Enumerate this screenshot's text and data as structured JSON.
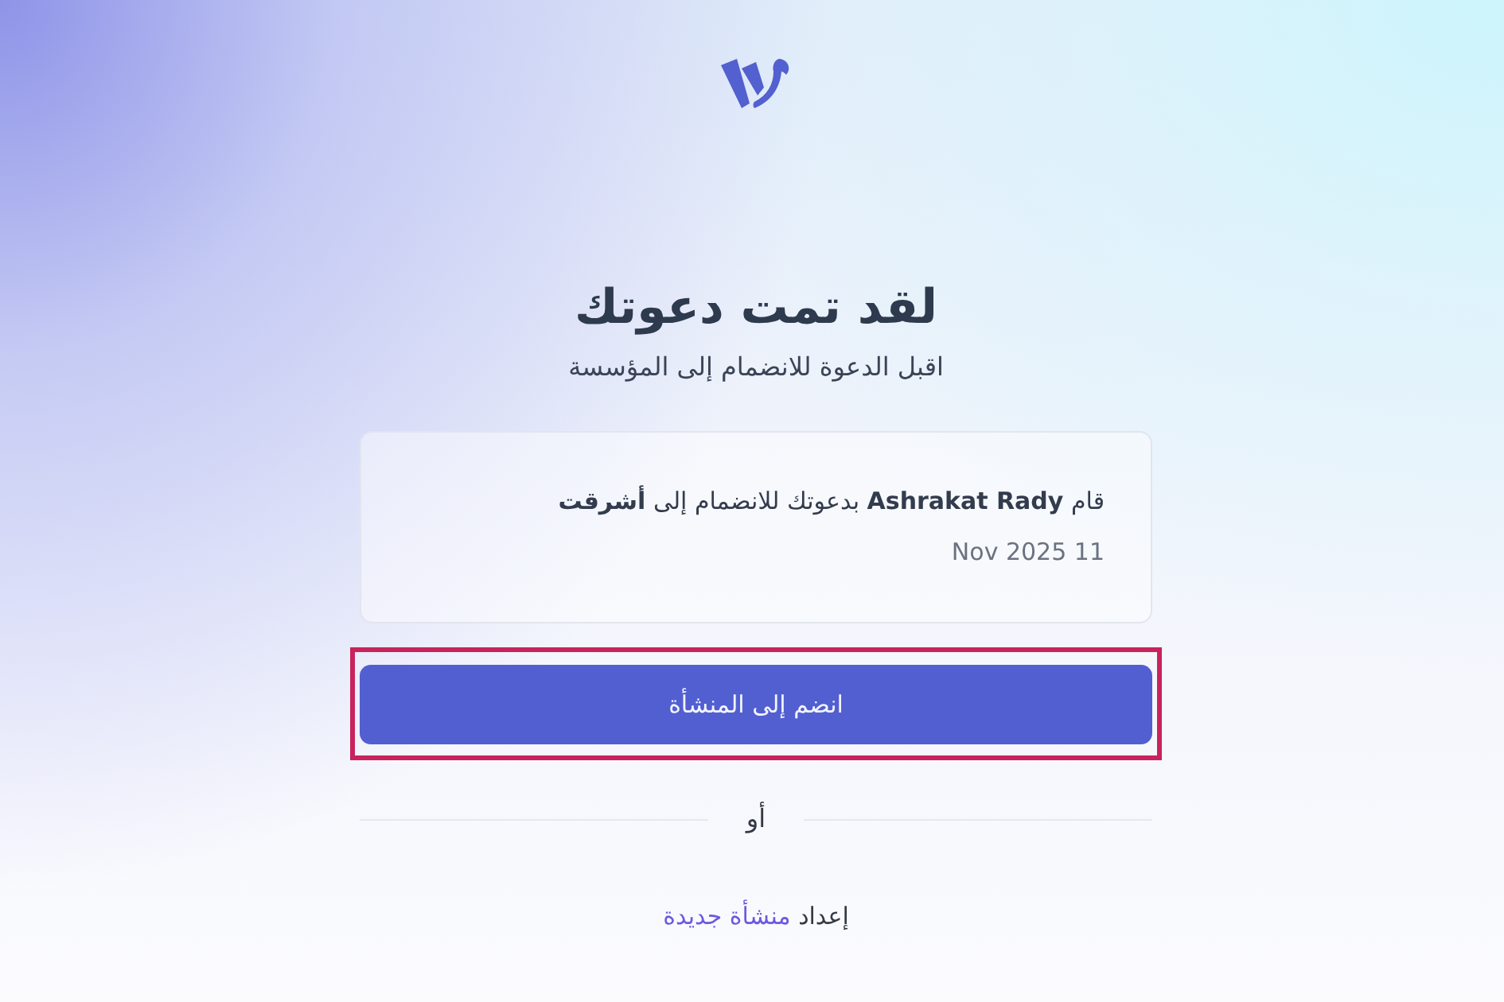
{
  "title": "لقد تمت دعوتك",
  "subtitle": "اقبل الدعوة للانضمام إلى المؤسسة",
  "invitation": {
    "message": "قام **Ashrakat Rady** بدعوتك للانضمام إلى **أشرقت**",
    "date": "Nov 2025 11"
  },
  "join_button": {
    "label": "انضم إلى المنشأة",
    "highlighted": true
  },
  "divider": {
    "label": "أو"
  },
  "footer": {
    "text": "إعداد",
    "link": "منشأة جديدة"
  }
}
